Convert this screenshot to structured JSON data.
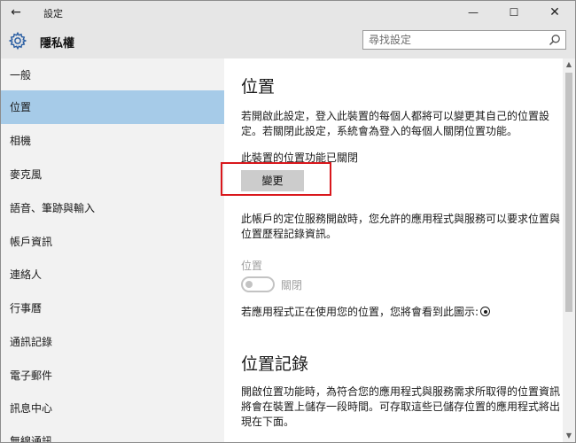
{
  "titlebar": {
    "back_glyph": "←",
    "app_title": "設定",
    "minimize_glyph": "—",
    "maximize_glyph": "☐",
    "close_glyph": "✕"
  },
  "header": {
    "page_title": "隱私權",
    "search_placeholder": "尋找設定"
  },
  "sidebar": {
    "items": [
      {
        "label": "一般"
      },
      {
        "label": "位置"
      },
      {
        "label": "相機"
      },
      {
        "label": "麥克風"
      },
      {
        "label": "語音、筆跡與輸入"
      },
      {
        "label": "帳戶資訊"
      },
      {
        "label": "連絡人"
      },
      {
        "label": "行事曆"
      },
      {
        "label": "通訊記錄"
      },
      {
        "label": "電子郵件"
      },
      {
        "label": "訊息中心"
      },
      {
        "label": "無線通訊"
      }
    ],
    "selected_label": "位置"
  },
  "content": {
    "section1_title": "位置",
    "section1_desc": "若開啟此設定，登入此裝置的每個人都將可以變更其自己的位置設定。若關閉此設定，系統會為登入的每個人關閉位置功能。",
    "device_status": "此裝置的位置功能已關閉",
    "change_button": "變更",
    "account_desc": "此帳戶的定位服務開啟時，您允許的應用程式與服務可以要求位置與位置歷程記錄資訊。",
    "toggle_label": "位置",
    "toggle_state": "關閉",
    "in_use_text": "若應用程式正在使用您的位置，您將會看到此圖示:",
    "section2_title": "位置記錄",
    "section2_desc": "開啟位置功能時，為符合您的應用程式與服務需求所取得的位置資訊將會在裝置上儲存一段時間。可存取這些已儲存位置的應用程式將出現在下面。"
  },
  "scrollbar": {
    "up_glyph": "▲",
    "down_glyph": "▼"
  },
  "colors": {
    "selected_nav": "#a6cbe8",
    "highlight_box": "#d9171c",
    "button_bg": "#cccccc",
    "disabled_text": "#a0a0a0"
  }
}
